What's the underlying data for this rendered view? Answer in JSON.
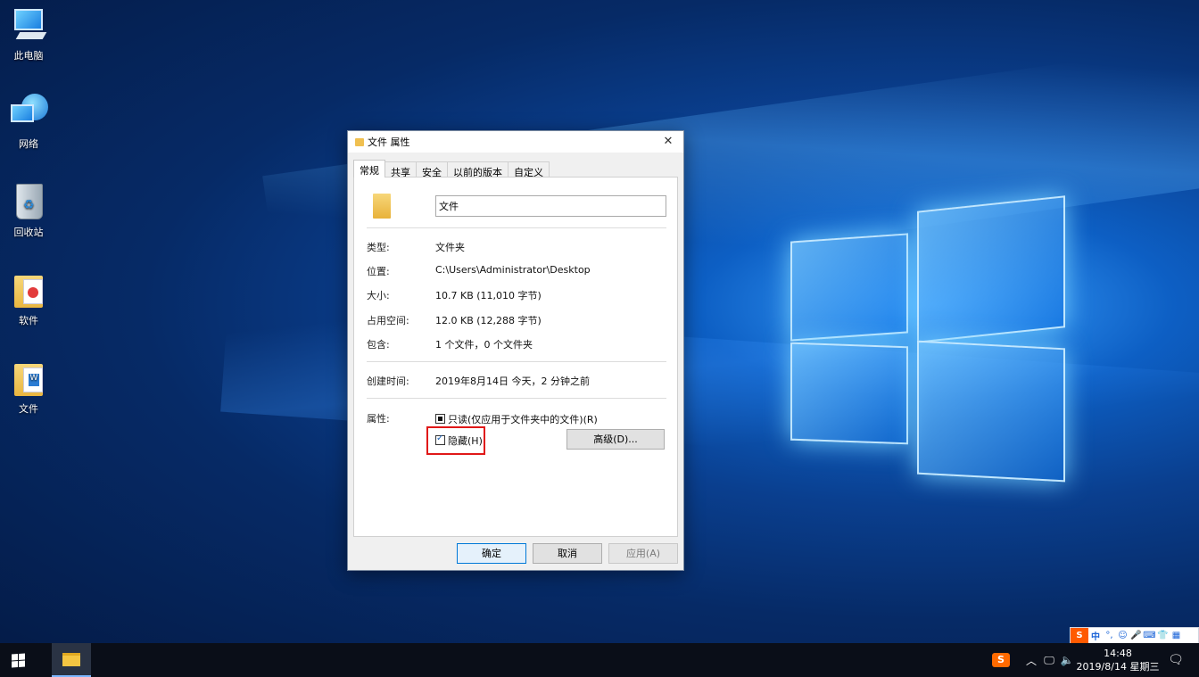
{
  "desktop": {
    "icons": [
      {
        "label": "此电脑",
        "icon": "this-pc-icon"
      },
      {
        "label": "网络",
        "icon": "network-icon"
      },
      {
        "label": "回收站",
        "icon": "recycle-bin-icon"
      },
      {
        "label": "软件",
        "icon": "folder-icon"
      },
      {
        "label": "文件",
        "icon": "folder-icon"
      }
    ]
  },
  "dialog": {
    "title": "文件 属性",
    "close_glyph": "✕",
    "tabs": [
      "常规",
      "共享",
      "安全",
      "以前的版本",
      "自定义"
    ],
    "active_tab": "常规",
    "name_value": "文件",
    "rows": {
      "type_label": "类型:",
      "type_value": "文件夹",
      "location_label": "位置:",
      "location_value": "C:\\Users\\Administrator\\Desktop",
      "size_label": "大小:",
      "size_value": "10.7 KB (11,010 字节)",
      "disk_label": "占用空间:",
      "disk_value": "12.0 KB (12,288 字节)",
      "contains_label": "包含:",
      "contains_value": "1 个文件，0 个文件夹",
      "created_label": "创建时间:",
      "created_value": "2019年8月14日 今天，2 分钟之前",
      "attributes_label": "属性:"
    },
    "readonly_label": "只读(仅应用于文件夹中的文件)(R)",
    "readonly_state": "indeterminate",
    "hidden_label": "隐藏(H)",
    "hidden_state": "checked",
    "advanced_button": "高级(D)...",
    "ok_button": "确定",
    "cancel_button": "取消",
    "apply_button": "应用(A)",
    "highlight_color": "#e01818"
  },
  "taskbar": {
    "time": "14:48",
    "date": "2019/8/14 星期三",
    "tray_icons": [
      "chevron-up-icon",
      "network-icon",
      "volume-icon"
    ],
    "ime_letter": "S",
    "ime_mode": "中",
    "ime_glyphs": [
      "°,",
      "☺",
      "🎤",
      "⌨",
      "👕",
      "▦"
    ]
  }
}
